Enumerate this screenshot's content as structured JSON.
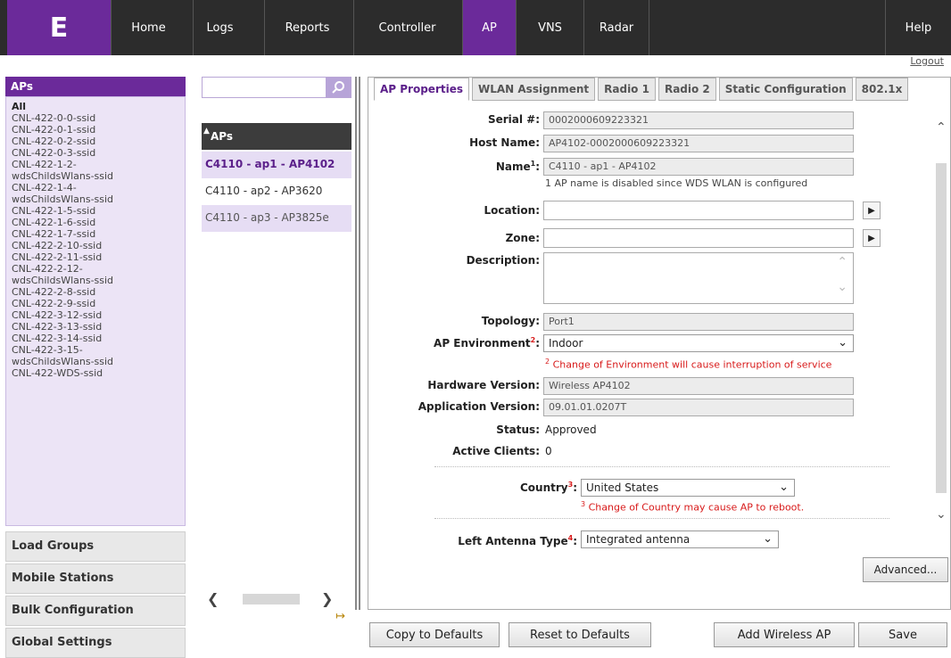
{
  "nav": {
    "logo": "E",
    "items": [
      "Home",
      "Logs",
      "Reports",
      "Controller",
      "AP",
      "VNS",
      "Radar",
      "Help"
    ],
    "logout": "Logout"
  },
  "sidebar": {
    "header": "APs",
    "all": "All",
    "items": [
      "CNL-422-0-0-ssid",
      "CNL-422-0-1-ssid",
      "CNL-422-0-2-ssid",
      "CNL-422-0-3-ssid",
      "CNL-422-1-2-",
      "wdsChildsWlans-ssid",
      "CNL-422-1-4-",
      "wdsChildsWlans-ssid",
      "CNL-422-1-5-ssid",
      "CNL-422-1-6-ssid",
      "CNL-422-1-7-ssid",
      "CNL-422-2-10-ssid",
      "CNL-422-2-11-ssid",
      "CNL-422-2-12-",
      "wdsChildsWlans-ssid",
      "CNL-422-2-8-ssid",
      "CNL-422-2-9-ssid",
      "CNL-422-3-12-ssid",
      "CNL-422-3-13-ssid",
      "CNL-422-3-14-ssid",
      "CNL-422-3-15-",
      "wdsChildsWlans-ssid",
      "CNL-422-WDS-ssid"
    ],
    "sections": [
      "Load Groups",
      "Mobile Stations",
      "Bulk Configuration",
      "Global Settings"
    ]
  },
  "aplist": {
    "search_value": "",
    "header": "APs",
    "rows": [
      "C4110 - ap1 - AP4102",
      "C4110 - ap2 - AP3620",
      "C4110 - ap3 - AP3825e"
    ]
  },
  "tabs": [
    "AP Properties",
    "WLAN Assignment",
    "Radio 1",
    "Radio 2",
    "Static Configuration",
    "802.1x"
  ],
  "form": {
    "serial_label": "Serial #:",
    "serial": "0002000609223321",
    "host_label": "Host Name:",
    "host": "AP4102-0002000609223321",
    "name_label": "Name",
    "name_sup": "1",
    "name": "C4110 - ap1 - AP4102",
    "name_note": "1 AP name is disabled since WDS WLAN is configured",
    "location_label": "Location:",
    "location": "",
    "zone_label": "Zone:",
    "zone": "",
    "desc_label": "Description:",
    "description": "",
    "topology_label": "Topology:",
    "topology": "Port1",
    "env_label": "AP Environment",
    "env_sup": "2",
    "environment": "Indoor",
    "env_note_sup": "2",
    "env_note": "Change of Environment will cause interruption of service",
    "hw_label": "Hardware Version:",
    "hardware": "Wireless AP4102",
    "app_label": "Application Version:",
    "application": "09.01.01.0207T",
    "status_label": "Status:",
    "status": "Approved",
    "clients_label": "Active Clients:",
    "clients": "0",
    "country_label": "Country",
    "country_sup": "3",
    "country": "United States",
    "country_note_sup": "3",
    "country_note": "Change of Country may cause AP to reboot.",
    "antenna_label": "Left Antenna Type",
    "antenna_sup": "4",
    "antenna": "Integrated antenna",
    "colon": ":",
    "advanced": "Advanced..."
  },
  "buttons": {
    "copy": "Copy to Defaults",
    "reset": "Reset to Defaults",
    "add": "Add Wireless AP",
    "save": "Save"
  },
  "colors": {
    "brand": "#6b2a9a",
    "nav_bg": "#2c2c2c",
    "alert": "#d81b1b"
  }
}
